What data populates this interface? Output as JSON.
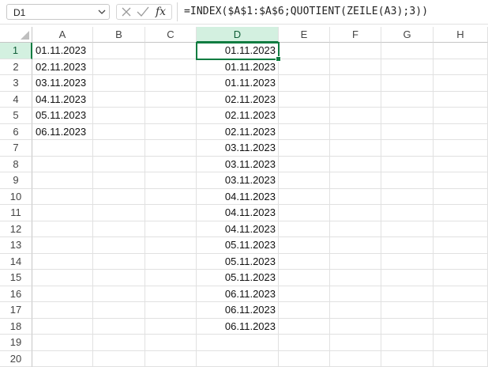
{
  "namebox": {
    "value": "D1"
  },
  "formula_bar": {
    "formula": "=INDEX($A$1:$A$6;QUOTIENT(ZEILE(A3);3))"
  },
  "columns": [
    "A",
    "B",
    "C",
    "D",
    "E",
    "F",
    "G",
    "H"
  ],
  "rows": [
    "1",
    "2",
    "3",
    "4",
    "5",
    "6",
    "7",
    "8",
    "9",
    "10",
    "11",
    "12",
    "13",
    "14",
    "15",
    "16",
    "17",
    "18",
    "19",
    "20"
  ],
  "column_a": [
    "01.11.2023",
    "02.11.2023",
    "03.11.2023",
    "04.11.2023",
    "05.11.2023",
    "06.11.2023"
  ],
  "column_d": [
    "01.11.2023",
    "01.11.2023",
    "01.11.2023",
    "02.11.2023",
    "02.11.2023",
    "02.11.2023",
    "03.11.2023",
    "03.11.2023",
    "03.11.2023",
    "04.11.2023",
    "04.11.2023",
    "04.11.2023",
    "05.11.2023",
    "05.11.2023",
    "05.11.2023",
    "06.11.2023",
    "06.11.2023",
    "06.11.2023"
  ],
  "selection": {
    "active_cell": "D1",
    "accent_color": "#107c41"
  },
  "icons": {
    "dropdown": "chevron-down-icon",
    "cancel": "cancel-x-icon",
    "enter": "checkmark-icon",
    "function": "fx-icon"
  }
}
